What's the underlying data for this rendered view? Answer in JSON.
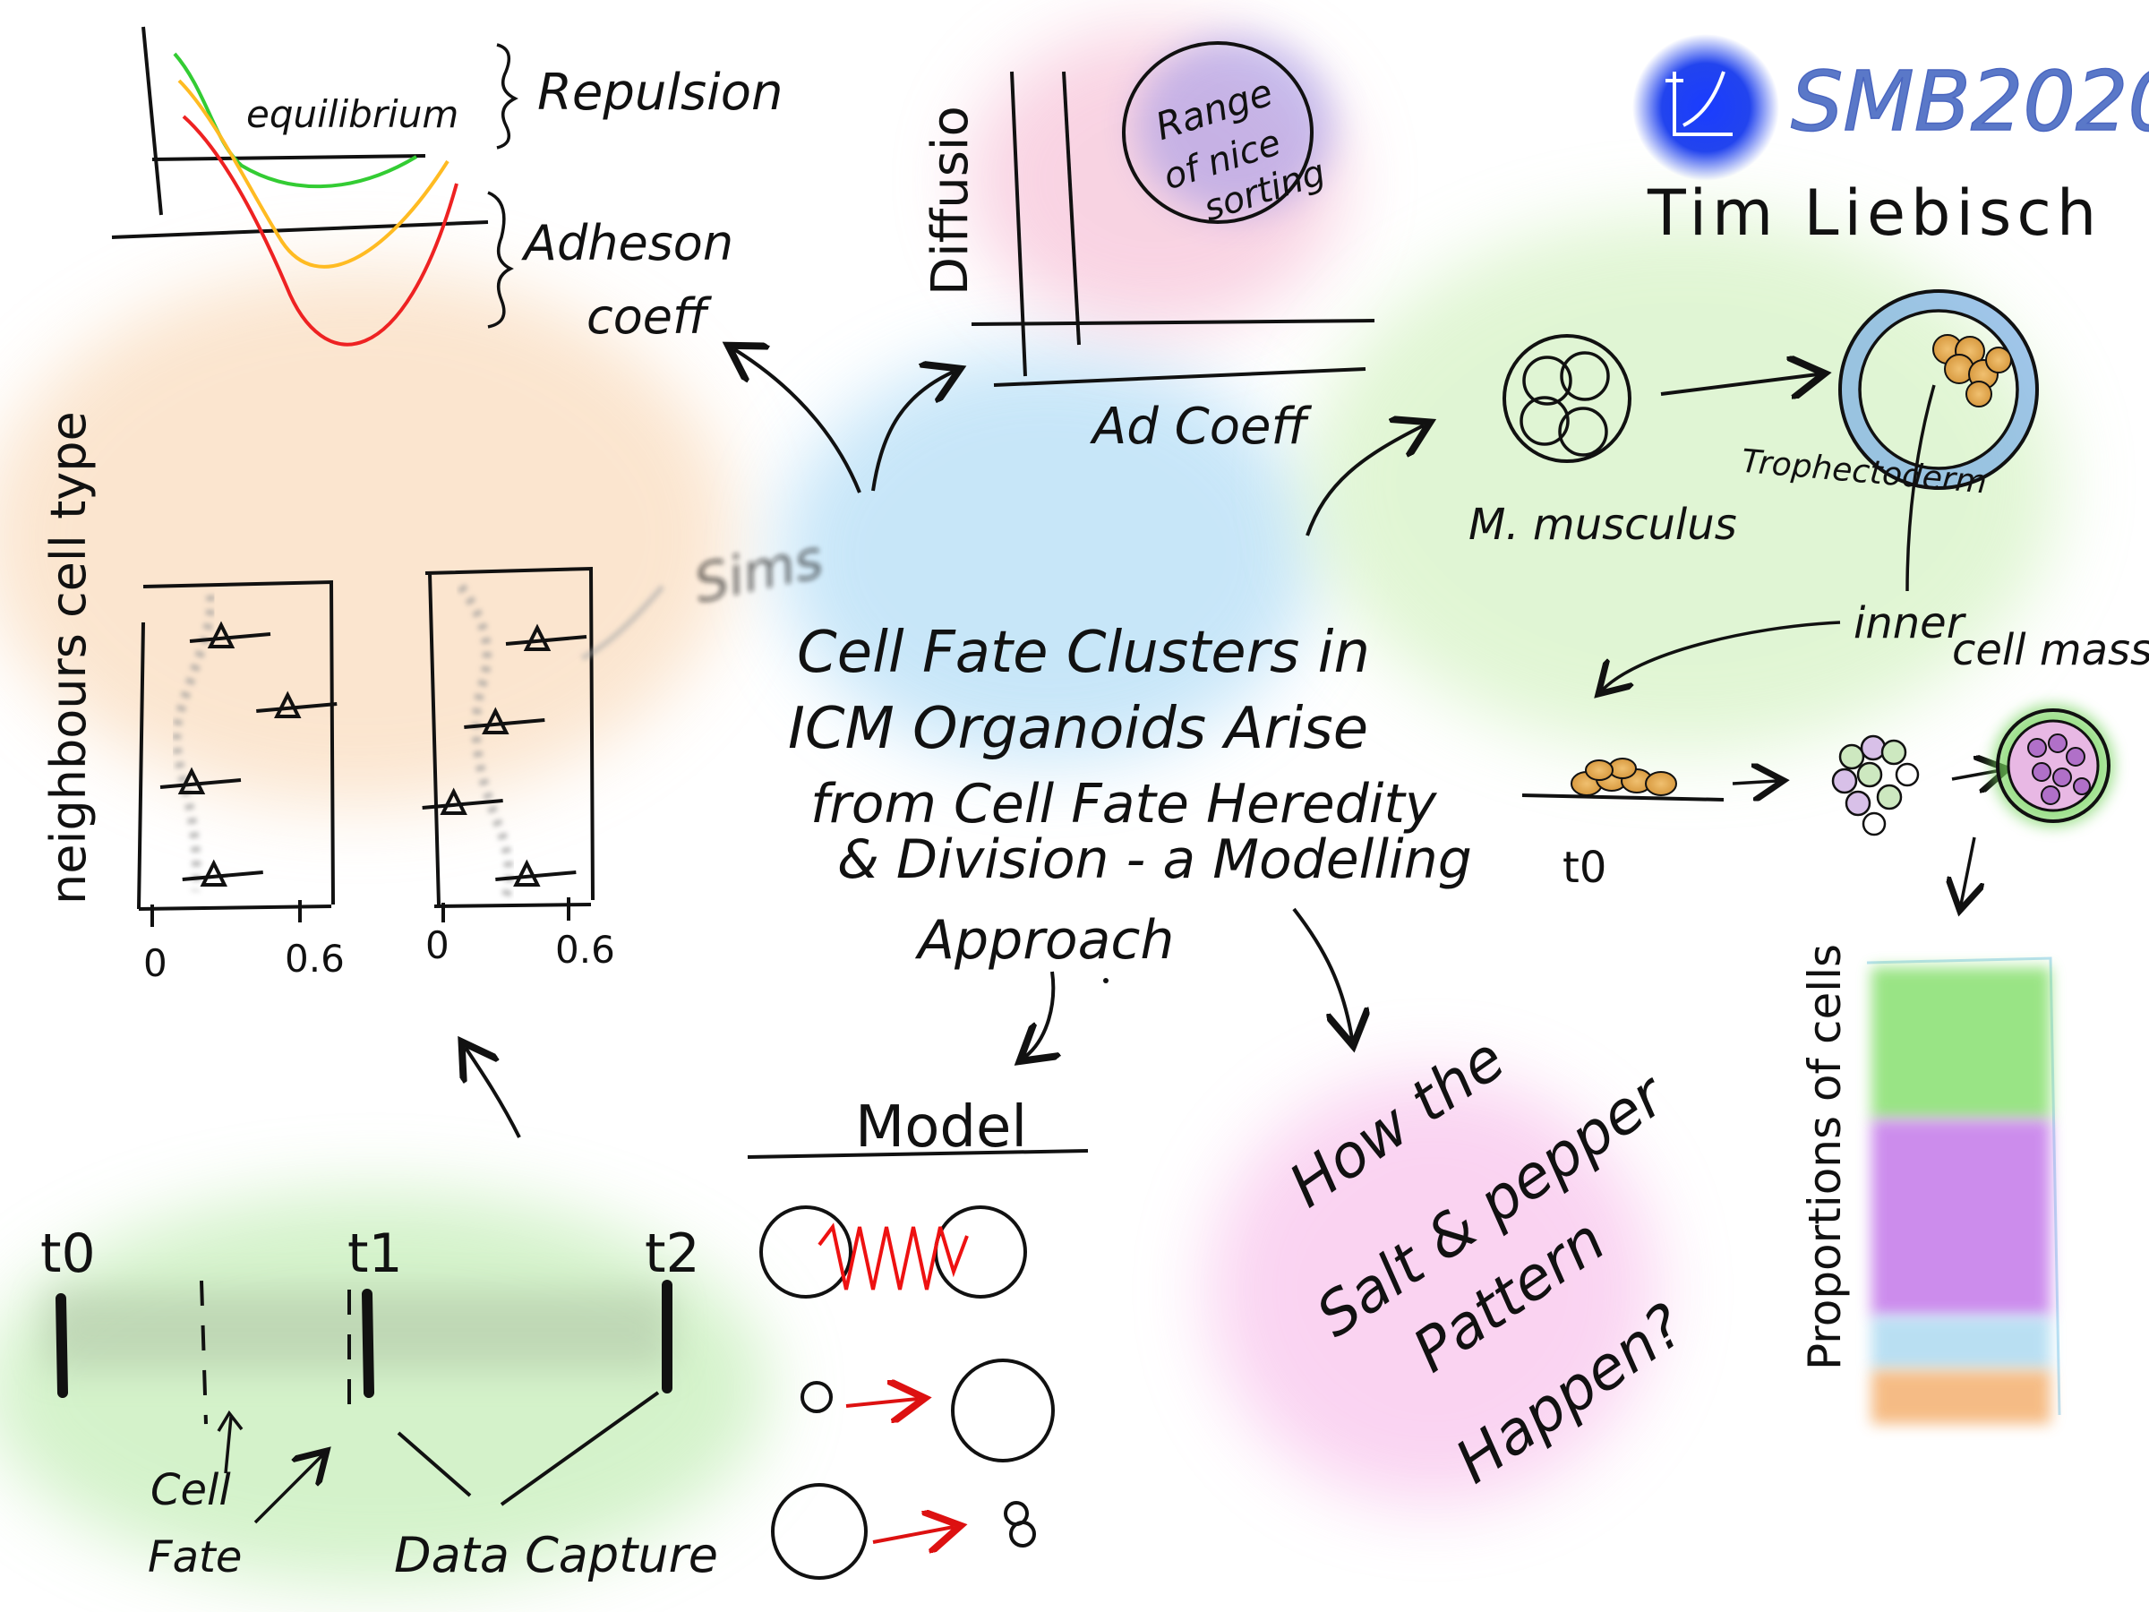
{
  "header": {
    "conference": "SMB2020",
    "speaker": "Tim Liebisch"
  },
  "center": {
    "title_lines": [
      "Cell Fate Clusters in",
      "ICM Organoids Arise",
      "from Cell Fate Heredity",
      "& Division - a Modelling",
      "Approach"
    ]
  },
  "potential": {
    "equilibrium": "equilibrium",
    "repulsion": "Repulsion",
    "adhesion_lines": [
      "Adheson",
      "coeff"
    ],
    "curve_colors": [
      "#33cc33",
      "#ffbb22",
      "#ee2222"
    ]
  },
  "phase": {
    "y_label": "Diffusio",
    "x_label": "Ad Coeff",
    "region_lines": [
      "Range",
      "of nice",
      "sorting"
    ]
  },
  "embryo": {
    "species": "M. musculus",
    "trophectoderm": "Trophectoderm",
    "icm_lines": [
      "inner",
      "cell mass"
    ],
    "t0": "t0"
  },
  "neighbours": {
    "y_label": "neighbours cell type",
    "sims": "Sims",
    "tick_min": "0",
    "tick_max": "0.6",
    "panel1_values": [
      0.28,
      0.55,
      0.16,
      0.25
    ],
    "panel2_values": [
      0.45,
      0.25,
      0.05,
      0.4
    ]
  },
  "timeline": {
    "labels": [
      "t0",
      "t1",
      "t2"
    ],
    "cell_fate_lines": [
      "Cell",
      "Fate"
    ],
    "data_capture": "Data Capture"
  },
  "model": {
    "title": "Model"
  },
  "question": {
    "lines": [
      "How the",
      "Salt & pepper",
      "Pattern",
      "Happen?"
    ]
  },
  "proportions": {
    "label": "Proportions of cells",
    "colors": [
      "#88e070",
      "#c070e8",
      "#a8d8f0",
      "#f4b070"
    ],
    "values": [
      0.28,
      0.36,
      0.1,
      0.14
    ]
  }
}
